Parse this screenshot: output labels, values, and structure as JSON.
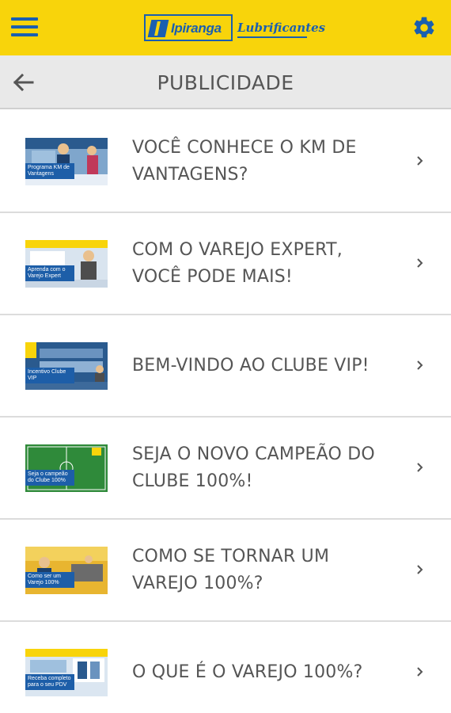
{
  "header": {
    "brand_name": "Ipiranga",
    "brand_sub": "Lubrificantes",
    "menu_icon": "hamburger-menu-icon",
    "settings_icon": "gear-icon",
    "accent_color": "#f8d40b",
    "brand_color": "#1a5fb0"
  },
  "subheader": {
    "title": "PUBLICIDADE",
    "back_icon": "arrow-left-icon"
  },
  "items": [
    {
      "title": "VOCÊ CONHECE O KM DE VANTAGENS?",
      "thumb_caption": "Programa KM de Vantagens"
    },
    {
      "title": "COM O VAREJO EXPERT, VOCÊ PODE MAIS!",
      "thumb_caption": "Aprenda com o Varejo Expert"
    },
    {
      "title": "BEM-VINDO AO CLUBE VIP!",
      "thumb_caption": "Incentivo Clube VIP"
    },
    {
      "title": "SEJA O NOVO CAMPEÃO DO CLUBE 100%!",
      "thumb_caption": "Seja o campeão do Clube 100%"
    },
    {
      "title": "COMO SE TORNAR UM VAREJO 100%?",
      "thumb_caption": "Como ser um Varejo 100%"
    },
    {
      "title": "O QUE É O VAREJO 100%?",
      "thumb_caption": "Receba completo para o seu PDV"
    }
  ]
}
